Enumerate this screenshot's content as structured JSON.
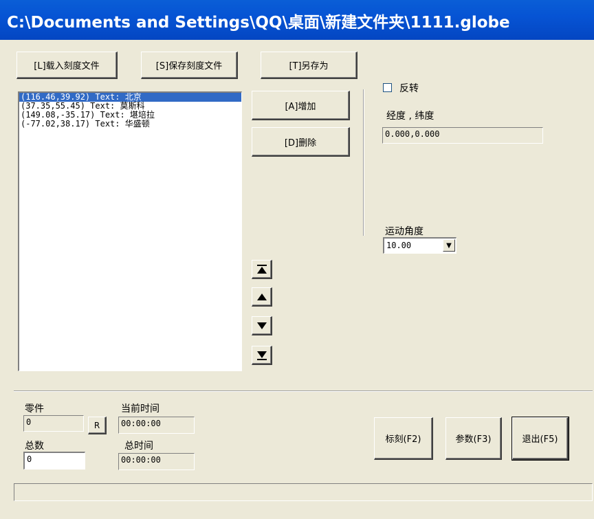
{
  "window": {
    "title": "C:\\Documents and Settings\\QQ\\桌面\\新建文件夹\\1111.globe"
  },
  "toolbar": {
    "load_label": "[L]载入刻度文件",
    "save_label": "[S]保存刻度文件",
    "saveas_label": "[T]另存为"
  },
  "list": {
    "items": [
      "(116.46,39.92) Text: 北京",
      "(37.35,55.45) Text: 莫斯科",
      "(149.08,-35.17) Text: 堪培拉",
      "(-77.02,38.17) Text: 华盛顿"
    ],
    "selected_index": 0
  },
  "actions": {
    "add_label": "[A]增加",
    "delete_label": "[D]删除"
  },
  "nav": {
    "first_icon": "move-to-top-icon",
    "up_icon": "move-up-icon",
    "down_icon": "move-down-icon",
    "last_icon": "move-to-bottom-icon"
  },
  "options": {
    "reverse_label": "反转",
    "reverse_checked": false,
    "coord_label": "经度 , 纬度",
    "coord_value": "0.000,0.000",
    "angle_label": "运动角度",
    "angle_value": "10.00"
  },
  "bottom": {
    "parts_label": "零件",
    "parts_value": "0",
    "reset_label": "R",
    "total_label": "总数",
    "total_value": "0",
    "current_time_label": "当前时间",
    "current_time_value": "00:00:00",
    "total_time_label": "总时间",
    "total_time_value": "00:00:00",
    "calibrate_label": "标刻(F2)",
    "params_label": "参数(F3)",
    "exit_label": "退出(F5)"
  }
}
